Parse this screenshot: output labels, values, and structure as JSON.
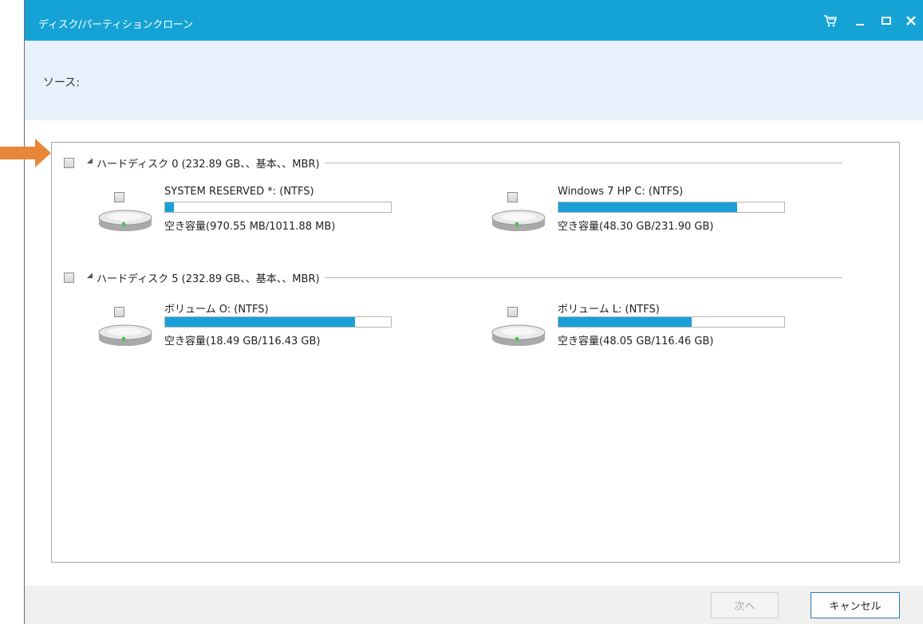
{
  "window": {
    "title": "ディスク/パーティションクローン",
    "title_bar_color": "#15a3d5"
  },
  "title_controls": [
    {
      "icon": "cart-icon"
    },
    {
      "icon": "minimize-icon"
    },
    {
      "icon": "maximize-icon"
    },
    {
      "icon": "close-icon"
    }
  ],
  "source": {
    "label": "ソース:"
  },
  "disks": [
    {
      "label": "ハードディスク 0 (232.89 GB、、基本、、MBR)",
      "checked": false,
      "partitions": [
        {
          "name": "SYSTEM RESERVED *: (NTFS)",
          "used_fraction": 0.04,
          "free_label": "空き容量(970.55 MB/1011.88 MB)",
          "checked": false
        },
        {
          "name": "Windows 7 HP C: (NTFS)",
          "used_fraction": 0.79,
          "free_label": "空き容量(48.30 GB/231.90 GB)",
          "checked": false
        }
      ]
    },
    {
      "label": "ハードディスク 5 (232.89 GB、、基本、、MBR)",
      "checked": false,
      "partitions": [
        {
          "name": "ボリューム O: (NTFS)",
          "used_fraction": 0.84,
          "free_label": "空き容量(18.49 GB/116.43 GB)",
          "checked": false
        },
        {
          "name": "ボリューム L: (NTFS)",
          "used_fraction": 0.59,
          "free_label": "空き容量(48.05 GB/116.46 GB)",
          "checked": false
        }
      ]
    }
  ],
  "footer": {
    "next_label": "次へ",
    "cancel_label": "キャンセル"
  },
  "colors": {
    "usage_bar": "#1b9fd9",
    "source_band": "#e6f1fb",
    "pointer_arrow": "#e8873a"
  }
}
